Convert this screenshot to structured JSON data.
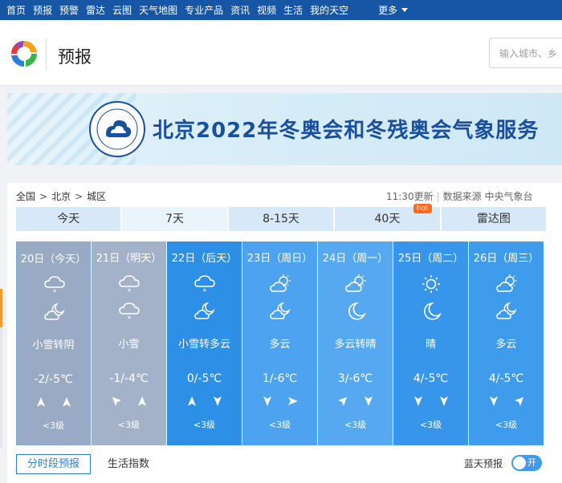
{
  "nav": {
    "items": [
      "首页",
      "预报",
      "预警",
      "雷达",
      "云图",
      "天气地图",
      "专业产品",
      "资讯",
      "视频",
      "生活",
      "我的天空"
    ],
    "more": "更多"
  },
  "header": {
    "title": "预报",
    "search_placeholder": "输入城市、乡"
  },
  "banner": {
    "title": "北京2022年冬奥会和冬残奥会气象服务"
  },
  "breadcrumb": [
    "全国",
    "北京",
    "城区"
  ],
  "update": {
    "time": "11:30更新",
    "source": "数据来源 中央气象台"
  },
  "tabs": [
    {
      "label": "今天"
    },
    {
      "label": "7天"
    },
    {
      "label": "8-15天"
    },
    {
      "label": "40天",
      "badge": "hot"
    },
    {
      "label": "雷达图"
    }
  ],
  "days": [
    {
      "date": "20日（今天）",
      "icon_day": "light-snow-icon",
      "icon_night": "partly-cloudy-night-icon",
      "weather": "小雪转阴",
      "temp": "-2/-5℃",
      "wind1": "north-arrow",
      "wind2": "north-arrow",
      "level": "<3级"
    },
    {
      "date": "21日（明天）",
      "icon_day": "light-snow-icon",
      "icon_night": "light-snow-icon",
      "weather": "小雪",
      "temp": "-1/-4℃",
      "wind1": "northwest-arrow",
      "wind2": "north-arrow",
      "level": "<3级"
    },
    {
      "date": "22日（后天）",
      "icon_day": "light-snow-icon",
      "icon_night": "partly-cloudy-night-icon",
      "weather": "小雪转多云",
      "temp": "0/-5℃",
      "wind1": "north-arrow",
      "wind2": "south-arrow",
      "level": "<3级"
    },
    {
      "date": "23日（周日）",
      "icon_day": "partly-cloudy-day-icon",
      "icon_night": "partly-cloudy-night-icon",
      "weather": "多云",
      "temp": "1/-6℃",
      "wind1": "south-arrow",
      "wind2": "east-arrow",
      "level": "<3级"
    },
    {
      "date": "24日（周一）",
      "icon_day": "partly-cloudy-day-icon",
      "icon_night": "moon-icon",
      "weather": "多云转晴",
      "temp": "3/-6℃",
      "wind1": "northeast-arrow",
      "wind2": "south-arrow",
      "level": "<3级"
    },
    {
      "date": "25日（周二）",
      "icon_day": "sunny-icon",
      "icon_night": "moon-icon",
      "weather": "晴",
      "temp": "4/-5℃",
      "wind1": "south-arrow",
      "wind2": "south-arrow",
      "level": "<3级"
    },
    {
      "date": "26日（周三）",
      "icon_day": "partly-cloudy-day-icon",
      "icon_night": "partly-cloudy-night-icon",
      "weather": "多云",
      "temp": "4/-5℃",
      "wind1": "south-arrow",
      "wind2": "northeast-arrow",
      "level": "<3级"
    }
  ],
  "bottom_tabs": [
    "分时段预报",
    "生活指数"
  ],
  "bluesky": {
    "label": "蓝天预报",
    "toggle": "开"
  },
  "colors": {
    "nav_bg": "#1755a5",
    "accent": "#2e7fd6",
    "tab_bg": "#d7e9f8",
    "hot": "#ff6a1f"
  }
}
